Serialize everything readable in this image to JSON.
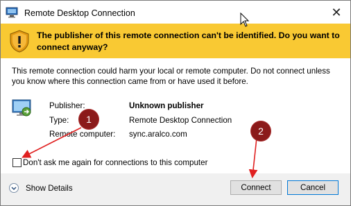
{
  "window": {
    "title": "Remote Desktop Connection",
    "close_glyph": "✕"
  },
  "banner": {
    "text": "The publisher of this remote connection can't be identified. Do you want to connect anyway?",
    "icon": "warning-shield-icon",
    "color": "#f9c933"
  },
  "warning": {
    "text": "This remote connection could harm your local or remote computer. Do not connect unless you know where this connection came from or have used it before."
  },
  "details": {
    "publisher_label": "Publisher:",
    "publisher_value": "Unknown publisher",
    "type_label": "Type:",
    "type_value": "Remote Desktop Connection",
    "remote_label": "Remote computer:",
    "remote_value": "sync.aralco.com"
  },
  "checkbox": {
    "label": "Don't ask me again for connections to this computer",
    "checked": false
  },
  "footer": {
    "show_details": "Show Details",
    "connect": "Connect",
    "cancel": "Cancel"
  },
  "annotations": [
    {
      "label": "1"
    },
    {
      "label": "2"
    }
  ],
  "colors": {
    "annotation": "#8b1a1a",
    "arrow": "#e02020",
    "accent": "#0078d7"
  }
}
